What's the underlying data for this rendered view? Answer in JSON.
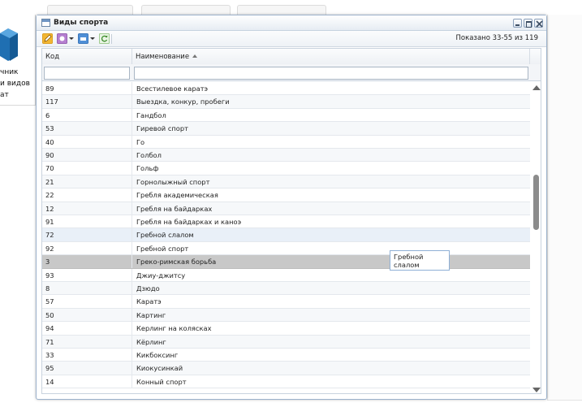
{
  "background": {
    "left_panel_text": "чник\nи видов\nат"
  },
  "window": {
    "title": "Виды спорта",
    "shown_label": "Показано 33-55 из 119"
  },
  "grid": {
    "columns": {
      "code": "Код",
      "name": "Наименование"
    },
    "filters": {
      "code_value": "",
      "name_value": ""
    },
    "rows": [
      {
        "code": "89",
        "name": "Всестилевое каратэ"
      },
      {
        "code": "117",
        "name": "Выездка, конкур, пробеги"
      },
      {
        "code": "6",
        "name": "Гандбол"
      },
      {
        "code": "53",
        "name": "Гиревой спорт"
      },
      {
        "code": "40",
        "name": "Го"
      },
      {
        "code": "90",
        "name": "Голбол"
      },
      {
        "code": "70",
        "name": "Гольф"
      },
      {
        "code": "21",
        "name": "Горнолыжный спорт"
      },
      {
        "code": "22",
        "name": "Гребля академическая"
      },
      {
        "code": "12",
        "name": "Гребля на байдарках"
      },
      {
        "code": "91",
        "name": "Гребля на байдарках и каноэ"
      },
      {
        "code": "72",
        "name": "Гребной слалом"
      },
      {
        "code": "92",
        "name": "Гребной спорт"
      },
      {
        "code": "3",
        "name": "Греко-римская борьба"
      },
      {
        "code": "93",
        "name": "Джиу-джитсу"
      },
      {
        "code": "8",
        "name": "Дзюдо"
      },
      {
        "code": "57",
        "name": "Каратэ"
      },
      {
        "code": "50",
        "name": "Картинг"
      },
      {
        "code": "94",
        "name": "Керлинг на колясках"
      },
      {
        "code": "71",
        "name": "Кёрлинг"
      },
      {
        "code": "33",
        "name": "Кикбоксинг"
      },
      {
        "code": "95",
        "name": "Киокусинкай"
      },
      {
        "code": "14",
        "name": "Конный спорт"
      }
    ],
    "hover_row": 11,
    "selected_row": 13
  },
  "tooltip": {
    "text": "Гребной слалом"
  },
  "colors": {
    "selected_row": "#c8c8c8",
    "hover_row": "#e9f0f8",
    "window_border": "#9cb2cc"
  }
}
